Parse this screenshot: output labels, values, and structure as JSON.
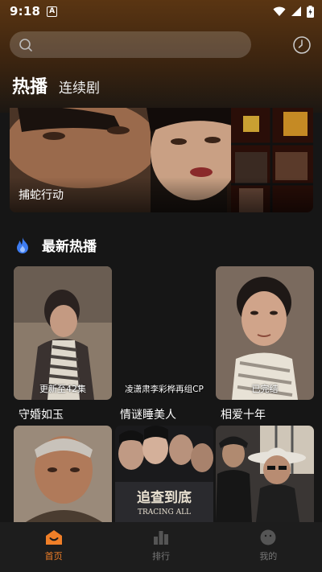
{
  "status_bar": {
    "time": "9:18",
    "notification_glyph": "A"
  },
  "search": {
    "placeholder": ""
  },
  "tabs": [
    {
      "label": "热播",
      "active": true
    },
    {
      "label": "连续剧",
      "active": false
    }
  ],
  "banner": {
    "title": "捕蛇行动"
  },
  "section": {
    "title": "最新热播",
    "icon": "fire-icon"
  },
  "cards": [
    {
      "title": "守婚如玉",
      "badge": "更新至42集"
    },
    {
      "title": "情谜睡美人",
      "badge": "凌潇肃李彩桦再组CP"
    },
    {
      "title": "相爱十年",
      "badge": "已完结"
    }
  ],
  "poster_text": {
    "tracing_cn": "追查到底",
    "tracing_en": "TRACING ALL"
  },
  "bottom_nav": [
    {
      "label": "首页",
      "icon": "home-icon",
      "active": true
    },
    {
      "label": "排行",
      "icon": "ranking-icon",
      "active": false
    },
    {
      "label": "我的",
      "icon": "profile-icon",
      "active": false
    }
  ],
  "colors": {
    "accent": "#f07f28",
    "background": "#161616",
    "fire": "#3d7cf2"
  }
}
